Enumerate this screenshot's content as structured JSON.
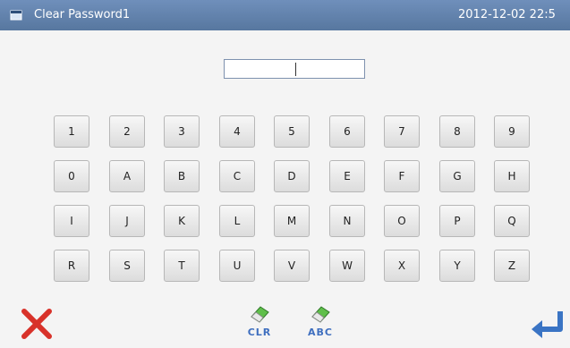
{
  "window": {
    "title": "Clear Password1",
    "datetime": "2012-12-02  22:5"
  },
  "password_field": {
    "value": ""
  },
  "keypad": {
    "rows": [
      [
        "1",
        "2",
        "3",
        "4",
        "5",
        "6",
        "7",
        "8",
        "9"
      ],
      [
        "0",
        "A",
        "B",
        "C",
        "D",
        "E",
        "F",
        "G",
        "H"
      ],
      [
        "I",
        "J",
        "K",
        "L",
        "M",
        "N",
        "O",
        "P",
        "Q"
      ],
      [
        "R",
        "S",
        "T",
        "U",
        "V",
        "W",
        "X",
        "Y",
        "Z"
      ]
    ]
  },
  "bottom_bar": {
    "cancel_icon": "red-x-icon",
    "clr_label": "CLR",
    "abc_label": "ABC",
    "enter_icon": "enter-arrow-icon"
  },
  "colors": {
    "titlebar": "#6386b4",
    "background": "#f4f4f4",
    "cancel": "#d8322a",
    "enter": "#3a74c4",
    "button_text": "#3f6fbf"
  }
}
